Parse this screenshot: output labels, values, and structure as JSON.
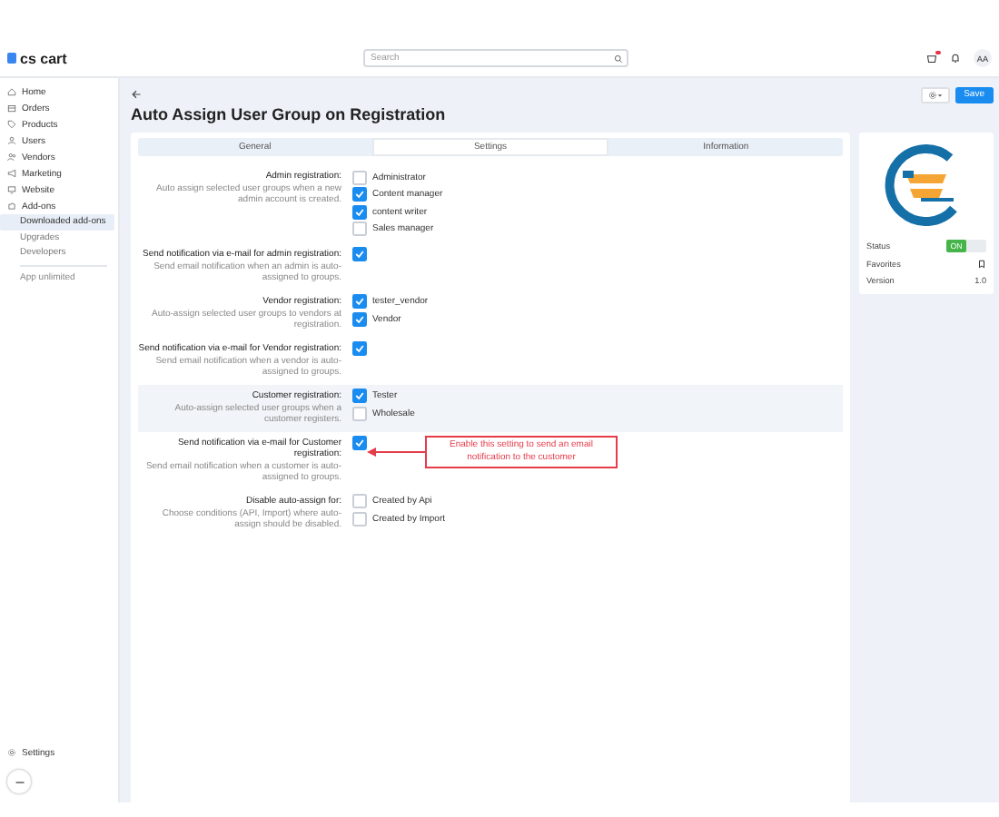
{
  "header": {
    "logo": "cs cart",
    "search": {
      "placeholder": "Search"
    },
    "avatar": "AA"
  },
  "sidebar": {
    "items": [
      {
        "label": "Home",
        "selected": false
      },
      {
        "label": "Orders",
        "selected": false
      },
      {
        "label": "Products",
        "selected": false
      },
      {
        "label": "Users",
        "selected": false
      },
      {
        "label": "Vendors",
        "selected": false
      },
      {
        "label": "Marketing",
        "selected": false
      },
      {
        "label": "Website",
        "selected": false
      },
      {
        "label": "Add-ons",
        "selected": false,
        "expanded": true,
        "children": [
          {
            "label": "Downloaded add-ons",
            "selected": true
          },
          {
            "label": "Upgrades",
            "selected": false
          },
          {
            "label": "Developers",
            "selected": false
          }
        ]
      }
    ],
    "extra": "App unlimited",
    "settings": "Settings"
  },
  "page": {
    "title": "Auto Assign User Group on Registration",
    "save": "Save"
  },
  "tabs": [
    {
      "label": "General",
      "selected": false
    },
    {
      "label": "Settings",
      "selected": true
    },
    {
      "label": "Information",
      "selected": false
    }
  ],
  "settings": [
    {
      "label": "Admin registration:",
      "description": "Auto assign selected user groups when a new admin account is created.",
      "kind": "checklist",
      "highlighted": false,
      "options": [
        {
          "label": "Administrator",
          "checked": false
        },
        {
          "label": "Content manager",
          "checked": true
        },
        {
          "label": "content writer",
          "checked": true
        },
        {
          "label": "Sales manager",
          "checked": false
        }
      ]
    },
    {
      "label": "Send notification via e-mail for admin registration:",
      "description": "Send email notification when an admin is auto-assigned to groups.",
      "kind": "checkbox",
      "highlighted": false,
      "checked": true
    },
    {
      "label": "Vendor registration:",
      "description": "Auto-assign selected user groups to vendors at registration.",
      "kind": "checklist",
      "highlighted": false,
      "options": [
        {
          "label": "tester_vendor",
          "checked": true
        },
        {
          "label": "Vendor",
          "checked": true
        }
      ]
    },
    {
      "label": "Send notification via e-mail for Vendor registration:",
      "description": "Send email notification when a vendor is auto-assigned to groups.",
      "kind": "checkbox",
      "highlighted": false,
      "checked": true
    },
    {
      "label": "Customer registration:",
      "description": "Auto-assign selected user groups when a customer registers.",
      "kind": "checklist",
      "highlighted": true,
      "options": [
        {
          "label": "Tester",
          "checked": true
        },
        {
          "label": "Wholesale",
          "checked": false
        }
      ]
    },
    {
      "label": "Send notification via e-mail for Customer registration:",
      "description": "Send email notification when a customer is auto-assigned to groups.",
      "kind": "checkbox",
      "highlighted": false,
      "checked": true,
      "callout": "Enable this setting to send an email notification to the customer"
    },
    {
      "label": "Disable auto-assign for:",
      "description": "Choose conditions (API, Import) where auto-assign should be disabled.",
      "kind": "checklist",
      "highlighted": false,
      "options": [
        {
          "label": "Created by Api",
          "checked": false
        },
        {
          "label": "Created by Import",
          "checked": false
        }
      ]
    }
  ],
  "addon": {
    "status_label": "Status",
    "status": {
      "label": "ON",
      "on": true
    },
    "favorites_label": "Favorites",
    "version_label": "Version",
    "version": "1.0"
  }
}
